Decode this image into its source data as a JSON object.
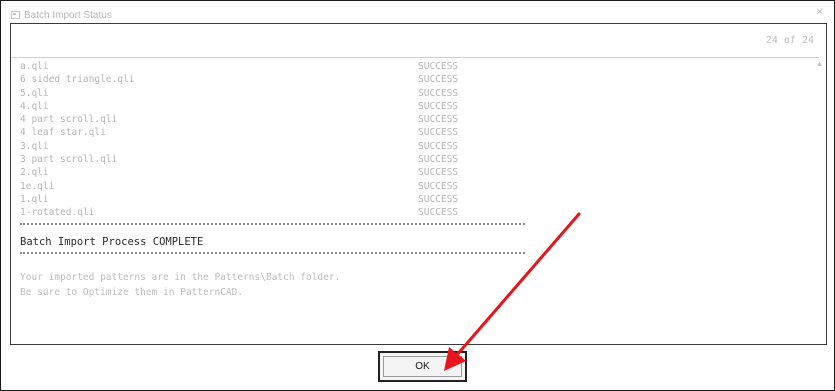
{
  "window": {
    "title": "Batch Import Status"
  },
  "counter": "24 of 24",
  "results": [
    {
      "file": "a.qli",
      "status": "SUCCESS"
    },
    {
      "file": "6 sided triangle.qli",
      "status": "SUCCESS"
    },
    {
      "file": "5.qli",
      "status": "SUCCESS"
    },
    {
      "file": "4.qli",
      "status": "SUCCESS"
    },
    {
      "file": "4 part scroll.qli",
      "status": "SUCCESS"
    },
    {
      "file": "4 leaf star.qli",
      "status": "SUCCESS"
    },
    {
      "file": "3.qli",
      "status": "SUCCESS"
    },
    {
      "file": "3 part scroll.qli",
      "status": "SUCCESS"
    },
    {
      "file": "2.qli",
      "status": "SUCCESS"
    },
    {
      "file": "1e.qli",
      "status": "SUCCESS"
    },
    {
      "file": "1.qli",
      "status": "SUCCESS"
    },
    {
      "file": "1-rotated.qli",
      "status": "SUCCESS"
    }
  ],
  "complete_text": "Batch Import Process COMPLETE",
  "message_lines": [
    "Your imported patterns are in the Patterns\\Batch folder.",
    "Be sure to Optimize them in PatternCAD."
  ],
  "ok_label": "OK",
  "colors": {
    "arrow": "#e8141c"
  },
  "icons": {
    "app": "app-window-icon",
    "close": "close-icon",
    "scroll_up": "scroll-up-arrow-icon"
  }
}
